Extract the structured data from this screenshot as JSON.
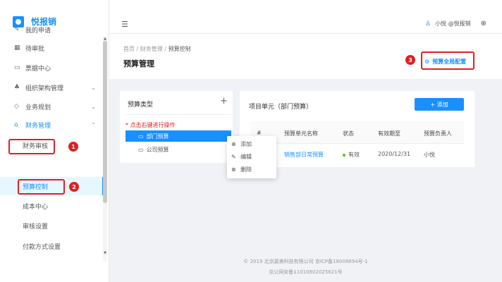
{
  "app": {
    "logo_text": "悦报销"
  },
  "sidebar": {
    "items": [
      {
        "label": "我的申请",
        "icon": "edit-icon"
      },
      {
        "label": "待审批",
        "icon": "grid-icon"
      },
      {
        "label": "票据中心",
        "icon": "receipt-icon"
      },
      {
        "label": "组织架构管理",
        "icon": "org-icon"
      },
      {
        "label": "业务规划",
        "icon": "plan-icon"
      },
      {
        "label": "财务管理",
        "icon": "finance-icon"
      },
      {
        "label": "财务审核"
      },
      {
        "label": "预算控制"
      },
      {
        "label": "成本中心"
      },
      {
        "label": "审核设置"
      },
      {
        "label": "付款方式设置"
      }
    ]
  },
  "header": {
    "user": "小悦 @悦报销"
  },
  "breadcrumb": {
    "home": "首页",
    "sep": "/",
    "finance": "财务管理",
    "current": "预算控制"
  },
  "page_title": "预算管理",
  "global_config_label": "预算全局配置",
  "annotations": {
    "one": "1",
    "two": "2",
    "three": "3"
  },
  "left_panel": {
    "title": "预算类型",
    "plus": "+",
    "hint": "* 点击右键进行操作",
    "tree": [
      "部门预算",
      "公司预算"
    ]
  },
  "context_menu": {
    "add": "添加",
    "edit": "编辑",
    "delete": "删除"
  },
  "right_panel": {
    "title": "项目单元（部门预算）",
    "add_label": "+ 添加",
    "columns": [
      "#",
      "预算单元名称",
      "状态",
      "有效期至",
      "预算负责人"
    ],
    "rows": [
      {
        "name": "销售部日常预算",
        "status": "有效",
        "expiry": "2020/12/31",
        "owner": "小悦"
      }
    ]
  },
  "footer": {
    "line1": "© 2019 北京嘉美科技有限公司  京ICP备18008694号-1",
    "line2": "京公网安备11010802025621号"
  },
  "colors": {
    "primary": "#1890ff",
    "annotation": "#e02020",
    "status_ok": "#52c41a"
  }
}
